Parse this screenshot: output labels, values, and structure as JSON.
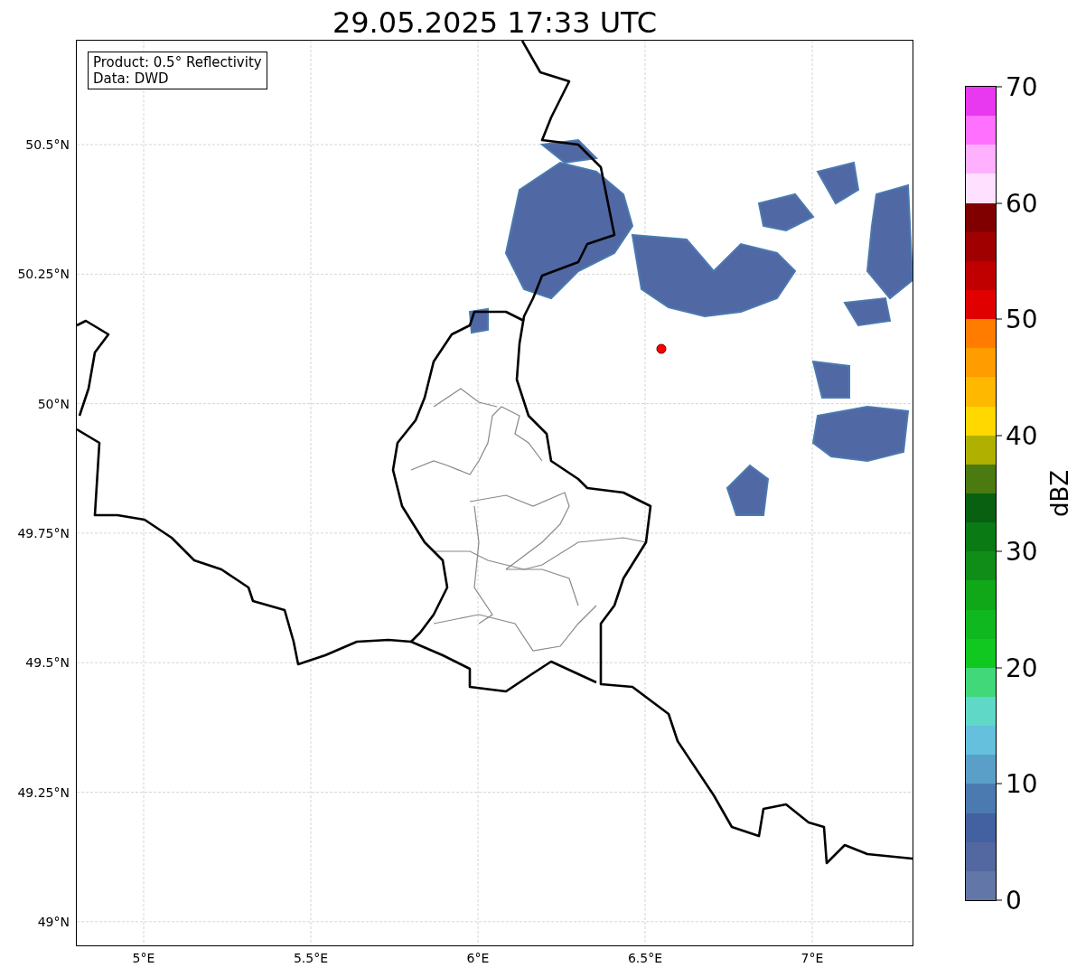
{
  "title": "29.05.2025 17:33 UTC",
  "info_box": {
    "lines": [
      "Product: 0.5° Reflectivity",
      "Data: DWD"
    ]
  },
  "map": {
    "lat_ticks": [
      "50.5°N",
      "50.25°N",
      "50°N",
      "49.75°N",
      "49.5°N",
      "49.25°N",
      "49°N"
    ],
    "lon_ticks": [
      "5°E",
      "5.5°E",
      "6°E",
      "6.5°E",
      "7°E"
    ]
  },
  "colorbar": {
    "label": "dBZ",
    "ticks": [
      "70",
      "60",
      "50",
      "40",
      "30",
      "20",
      "10",
      "0"
    ],
    "segments": [
      {
        "color": "#6376a8"
      },
      {
        "color": "#5368a0"
      },
      {
        "color": "#4360a0"
      },
      {
        "color": "#4a7ab0"
      },
      {
        "color": "#5a9fc8"
      },
      {
        "color": "#64c0dc"
      },
      {
        "color": "#60d8c8"
      },
      {
        "color": "#40d878"
      },
      {
        "color": "#10c820"
      },
      {
        "color": "#10b820"
      },
      {
        "color": "#10a818"
      },
      {
        "color": "#108c18"
      },
      {
        "color": "#0a7a14"
      },
      {
        "color": "#086010"
      },
      {
        "color": "#4a7a10"
      },
      {
        "color": "#b0b000"
      },
      {
        "color": "#ffd800"
      },
      {
        "color": "#ffb800"
      },
      {
        "color": "#ff9c00"
      },
      {
        "color": "#ff7c00"
      },
      {
        "color": "#e00000"
      },
      {
        "color": "#c00000"
      },
      {
        "color": "#a00000"
      },
      {
        "color": "#800000"
      },
      {
        "color": "#ffe0ff"
      },
      {
        "color": "#ffb0ff"
      },
      {
        "color": "#ff70ff"
      },
      {
        "color": "#e838f0"
      }
    ]
  }
}
